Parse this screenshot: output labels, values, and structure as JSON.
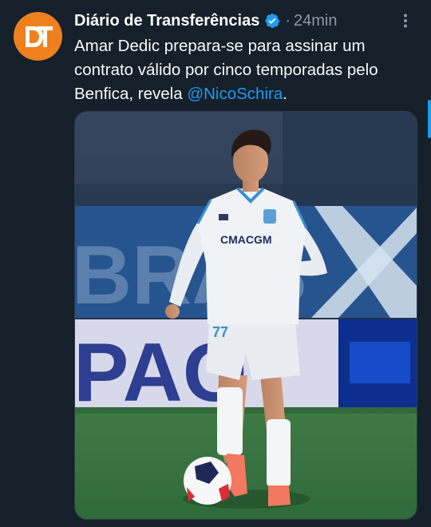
{
  "tweet": {
    "display_name": "Diário de Transferências",
    "separator": "·",
    "time": "24min",
    "text_before": "Amar Dedic prepara-se para assinar um contrato válido por cinco temporadas pelo Benfica, revela ",
    "mention": "@NicoSchira",
    "text_after": ".",
    "avatar_initials": "DT",
    "photo": {
      "sponsor": "CMACGM",
      "shirt_number": "77",
      "board_text": "PAO",
      "banner_text": "BRAS"
    }
  },
  "colors": {
    "background": "#15202b",
    "accent": "#1d9bf0",
    "avatar": "#f07f1d",
    "muted": "#8b98a5"
  },
  "icons": [
    "verified-badge-icon",
    "more-options-icon"
  ]
}
